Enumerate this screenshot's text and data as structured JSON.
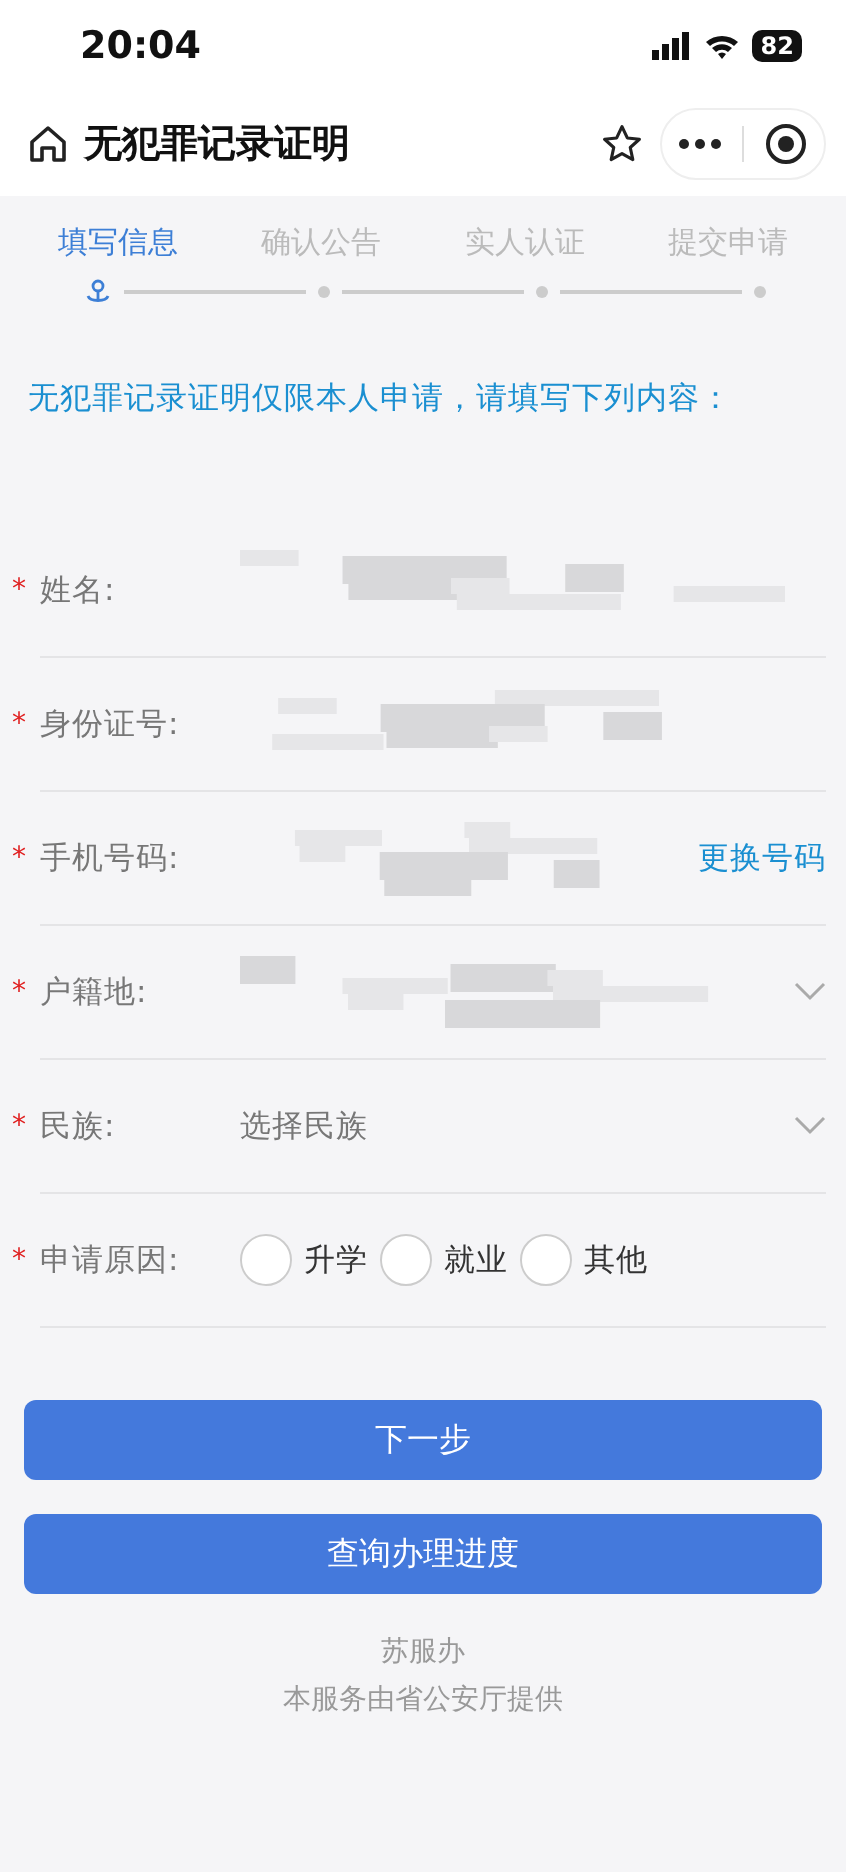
{
  "status_bar": {
    "time": "20:04",
    "battery": "82"
  },
  "header": {
    "title": "无犯罪记录证明"
  },
  "steps": [
    {
      "label": "填写信息",
      "selected": true
    },
    {
      "label": "确认公告",
      "selected": false
    },
    {
      "label": "实人认证",
      "selected": false
    },
    {
      "label": "提交申请",
      "selected": false
    }
  ],
  "intro": "无犯罪记录证明仅限本人申请，请填写下列内容：",
  "form": [
    {
      "kind": "text",
      "required": true,
      "mark": "*",
      "label": "姓名:",
      "redacted": true
    },
    {
      "kind": "text",
      "required": true,
      "mark": "*",
      "label": "身份证号:",
      "redacted": true
    },
    {
      "kind": "text",
      "required": true,
      "mark": "*",
      "label": "手机号码:",
      "redacted": true,
      "action": "更换号码"
    },
    {
      "kind": "select",
      "required": true,
      "mark": "*",
      "label": "户籍地:",
      "redacted": true
    },
    {
      "kind": "select",
      "required": true,
      "mark": "*",
      "label": "民族:",
      "placeholder": "选择民族"
    },
    {
      "kind": "radio",
      "required": true,
      "mark": "*",
      "label": "申请原因:",
      "options": [
        {
          "label": "升学",
          "selected": false
        },
        {
          "label": "就业",
          "selected": false
        },
        {
          "label": "其他",
          "selected": false
        }
      ]
    }
  ],
  "buttons": [
    "下一步",
    "查询办理进度"
  ],
  "footer": [
    "苏服办",
    "本服务由省公安厅提供"
  ]
}
